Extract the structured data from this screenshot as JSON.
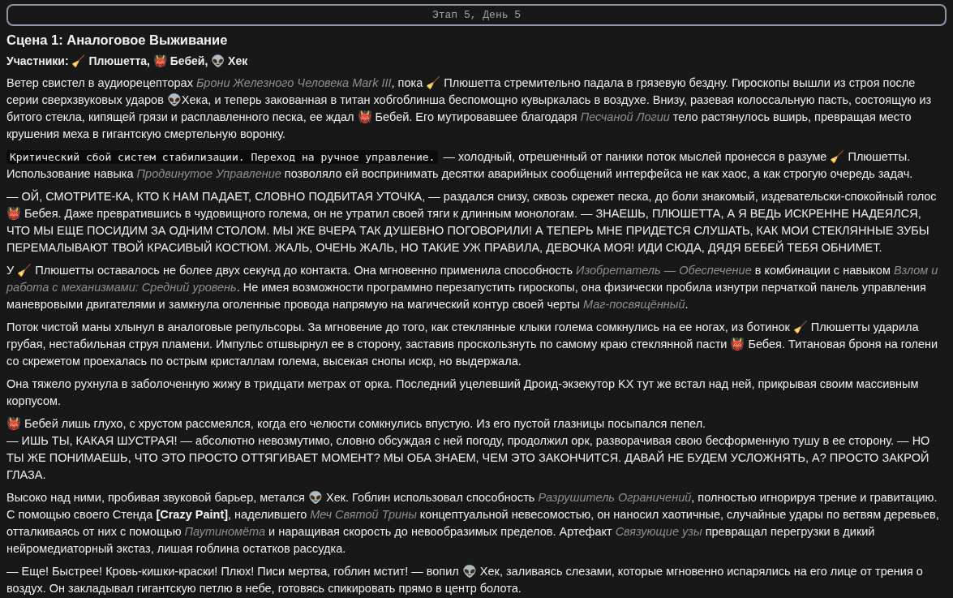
{
  "stage_bar": {
    "label": "Этап 5, День 5"
  },
  "scene_title": "Сцена 1: Аналоговое Выживание",
  "participants": "Участники: 🧹 Плюшетта, 👹 Бебей, 👽 Хек",
  "paragraphs": [
    {
      "kind": "text",
      "text": "Ветер свистел в аудиорецепторах *Брони Железного Человека Mark III*, пока 🧹 Плюшетта стремительно падала в грязевую бездну. Гироскопы вышли из строя после серии сверхзвуковых ударов 👽Хека, и теперь закованная в титан хобгоблинша беспомощно кувыркалась в воздухе. Внизу, разевая колоссальную пасть, состоящую из битого стекла, кипящей грязи и расплавленного песка, ее ждал 👹 Бебей. Его мутировавшее благодаря *Песчаной Логии* тело растянулось вширь, превращая место крушения меха в гигантскую смертельную воронку."
    },
    {
      "kind": "system",
      "code": "Критический сбой систем стабилизации. Переход на ручное управление.",
      "text": " — холодный, отрешенный от паники поток мыслей пронесся в разуме 🧹 Плюшетты. Использование навыка *Продвинутое Управление* позволяло ей воспринимать десятки аварийных сообщений интерфейса не как хаос, а как строгую очередь задач."
    },
    {
      "kind": "text",
      "text": "— ОЙ, СМОТРИТЕ-КА, КТО К НАМ ПАДАЕТ, СЛОВНО ПОДБИТАЯ УТОЧКА, — раздался снизу, сквозь скрежет песка, до боли знакомый, издевательски-спокойный голос 👹 Бебея. Даже превратившись в чудовищного голема, он не утратил своей тяги к длинным монологам. — ЗНАЕШЬ, ПЛЮШЕТТА, А Я ВЕДЬ ИСКРЕННЕ НАДЕЯЛСЯ, ЧТО МЫ ЕЩЕ ПОСИДИМ ЗА ОДНИМ СТОЛОМ. МЫ ЖЕ ВЧЕРА ТАК ДУШЕВНО ПОГОВОРИЛИ! А ТЕПЕРЬ МНЕ ПРИДЕТСЯ СЛУШАТЬ, КАК МОИ СТЕКЛЯННЫЕ ЗУБЫ ПЕРЕМАЛЫВАЮТ ТВОЙ КРАСИВЫЙ КОСТЮМ. ЖАЛЬ, ОЧЕНЬ ЖАЛЬ, НО ТАКИЕ УЖ ПРАВИЛА, ДЕВОЧКА МОЯ! ИДИ СЮДА, ДЯДЯ БЕБЕЙ ТЕБЯ ОБНИМЕТ."
    },
    {
      "kind": "text",
      "text": "У 🧹 Плюшетты оставалось не более двух секунд до контакта. Она мгновенно применила способность *Изобретатель — Обеспечение* в комбинации с навыком *Взлом и работа с механизмами: Средний уровень*. Не имея возможности программно перезапустить гироскопы, она физически пробила изнутри перчаткой панель управления маневровыми двигателями и замкнула оголенные провода напрямую на магический контур своей черты *Маг-посвящённый*."
    },
    {
      "kind": "text",
      "text": "Поток чистой маны хлынул в аналоговые репульсоры. За мгновение до того, как стеклянные клыки голема сомкнулись на ее ногах, из ботинок 🧹 Плюшетты ударила грубая, нестабильная струя пламени. Импульс отшвырнул ее в сторону, заставив проскользнуть по самому краю стеклянной пасти 👹 Бебея. Титановая броня на голени со скрежетом проехалась по острым кристаллам голема, высекая снопы искр, но выдержала."
    },
    {
      "kind": "text",
      "text": "Она тяжело рухнула в заболоченную жижу в тридцати метрах от орка. Последний уцелевший Дроид-экзекутор KX тут же встал над ней, прикрывая своим массивным корпусом."
    },
    {
      "kind": "text",
      "text": "👹 Бебей лишь глухо, с хрустом рассмеялся, когда его челюсти сомкнулись впустую. Из его пустой глазницы посыпался пепел."
    },
    {
      "kind": "continuation",
      "text": "— ИШЬ ТЫ, КАКАЯ ШУСТРАЯ! — абсолютно невозмутимо, словно обсуждая с ней погоду, продолжил орк, разворачивая свою бесформенную тушу в ее сторону. — НО ТЫ ЖЕ ПОНИМАЕШЬ, ЧТО ЭТО ПРОСТО ОТТЯГИВАЕТ МОМЕНТ? МЫ ОБА ЗНАЕМ, ЧЕМ ЭТО ЗАКОНЧИТСЯ. ДАВАЙ НЕ БУДЕМ УСЛОЖНЯТЬ, А? ПРОСТО ЗАКРОЙ ГЛАЗА."
    },
    {
      "kind": "text",
      "text": "Высоко над ними, пробивая звуковой барьер, метался 👽 Хек. Гоблин использовал способность *Разрушитель Ограничений*, полностью игнорируя трение и гравитацию. С помощью своего Стенда **[Crazy Paint]**, наделившего *Меч Святой Трины* концептуальной невесомостью, он наносил хаотичные, случайные удары по ветвям деревьев, отталкиваясь от них с помощью *Паутиномёта* и наращивая скорость до невообразимых пределов. Артефакт *Связующие узы* превращал перегрузки в дикий нейромедиаторный экстаз, лишая гоблина остатков рассудка."
    },
    {
      "kind": "text",
      "text": "— Еще! Быстрее! Кровь-кишки-краски! Плюх! Писи мертва, гоблин мстит! — вопил 👽 Хек, заливаясь слезами, которые мгновенно испарялись на его лице от трения о воздух. Он закладывал гигантскую петлю в небе, готовясь спикировать прямо в центр болота."
    }
  ]
}
